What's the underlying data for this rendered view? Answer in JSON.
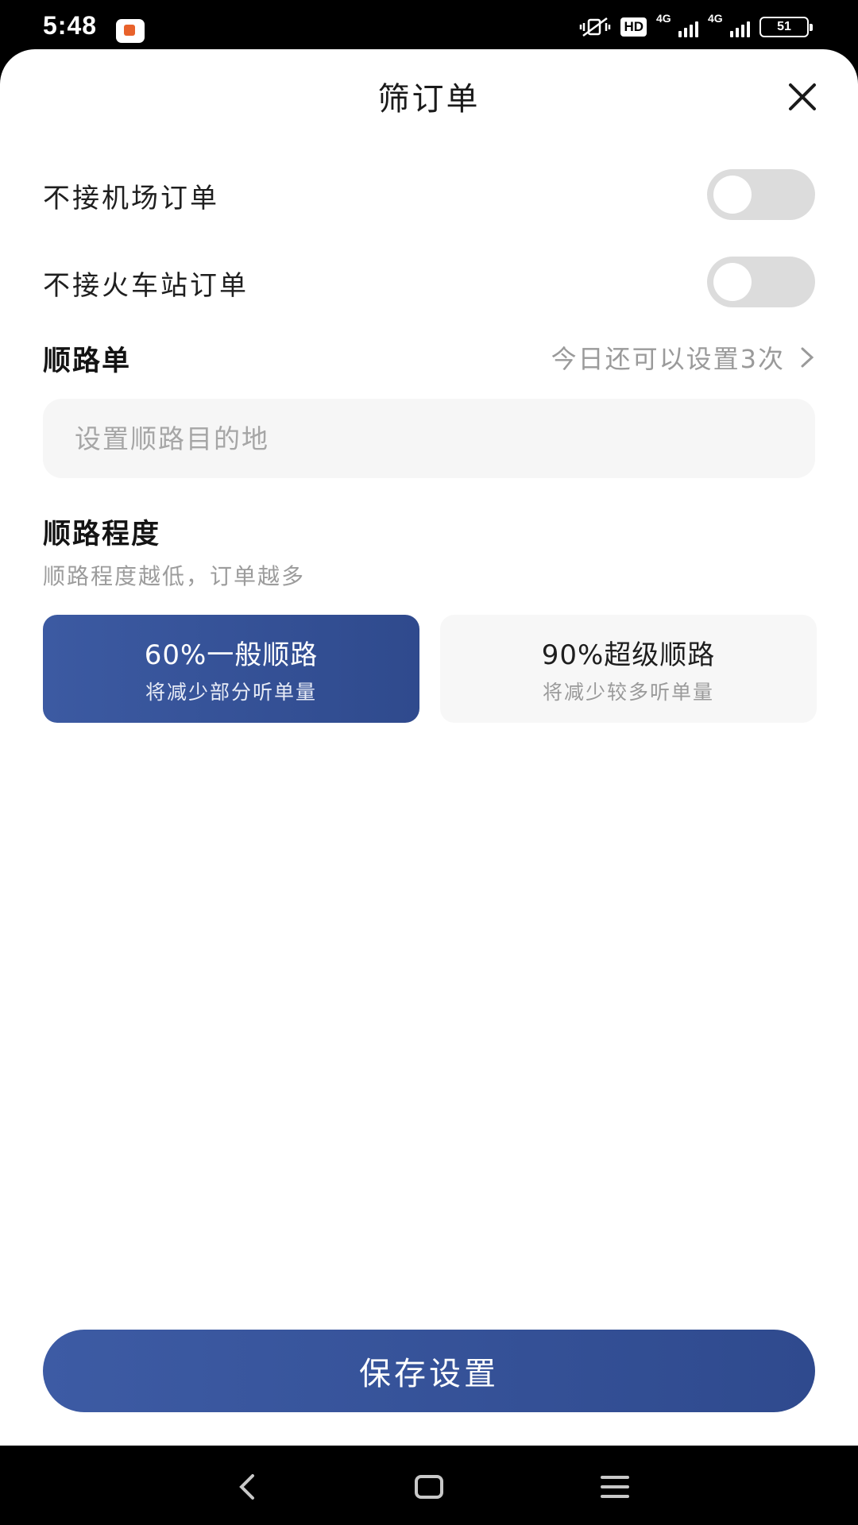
{
  "status_bar": {
    "time": "5:48",
    "hd_label": "HD",
    "net1_label": "4G",
    "net2_label": "4G",
    "battery": "51"
  },
  "sheet": {
    "title": "筛订单"
  },
  "filters": {
    "no_airport_label": "不接机场订单",
    "no_airport_on": false,
    "no_station_label": "不接火车站订单",
    "no_station_on": false
  },
  "route": {
    "title": "顺路单",
    "remaining_text": "今日还可以设置3次",
    "destination_placeholder": "设置顺路目的地",
    "destination_value": ""
  },
  "route_degree": {
    "title": "顺路程度",
    "hint": "顺路程度越低，订单越多",
    "options": [
      {
        "title": "60%一般顺路",
        "subtitle": "将减少部分听单量",
        "selected": true
      },
      {
        "title": "90%超级顺路",
        "subtitle": "将减少较多听单量",
        "selected": false
      }
    ]
  },
  "actions": {
    "save_label": "保存设置"
  },
  "colors": {
    "accent": "#3a55a0",
    "toggle_off": "#dcdcdc"
  }
}
